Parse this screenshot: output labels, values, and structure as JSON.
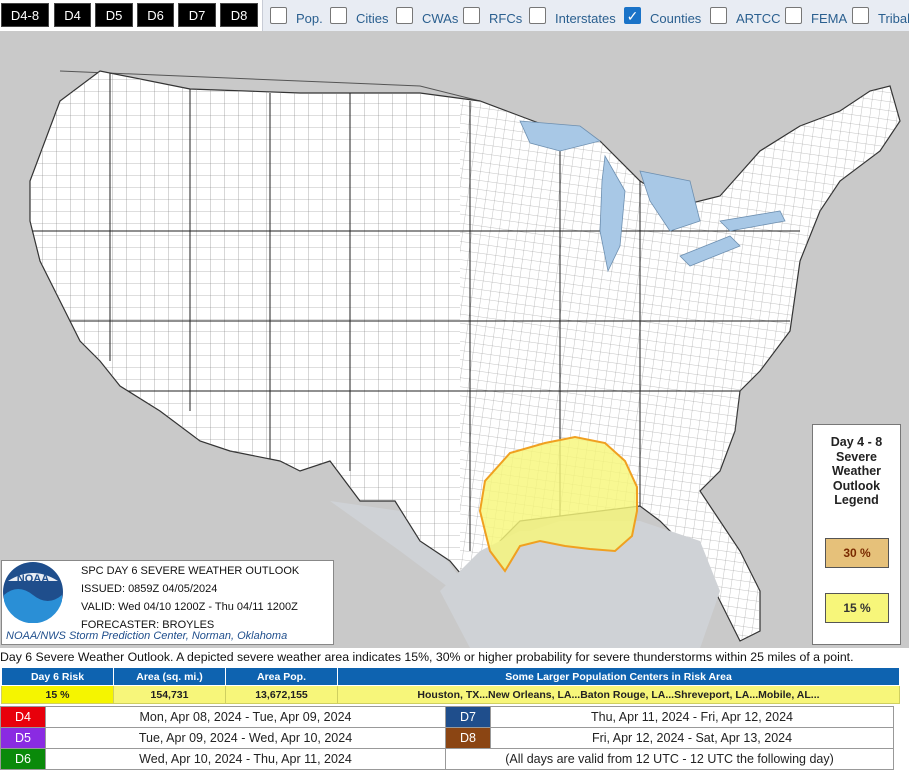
{
  "tabs": [
    "D4-8",
    "D4",
    "D5",
    "D6",
    "D7",
    "D8"
  ],
  "layers": [
    {
      "label": "Pop.",
      "checked": false
    },
    {
      "label": "Cities",
      "checked": false
    },
    {
      "label": "CWAs",
      "checked": false
    },
    {
      "label": "RFCs",
      "checked": false
    },
    {
      "label": "Interstates",
      "checked": false
    },
    {
      "label": "Counties",
      "checked": true
    },
    {
      "label": "ARTCC",
      "checked": false
    },
    {
      "label": "FEMA",
      "checked": false
    },
    {
      "label": "Tribal",
      "checked": false
    }
  ],
  "info_box": {
    "logo_text": "NOAA",
    "title": "SPC DAY 6 SEVERE WEATHER OUTLOOK",
    "issued": "ISSUED: 0859Z 04/05/2024",
    "valid": "VALID: Wed 04/10 1200Z - Thu 04/11 1200Z",
    "forecaster": "FORECASTER: BROYLES",
    "credit": "NOAA/NWS Storm Prediction Center, Norman, Oklahoma"
  },
  "legend": {
    "title_lines": [
      "Day 4 - 8",
      "Severe",
      "Weather",
      "Outlook",
      "Legend"
    ],
    "items": [
      {
        "label": "30 %",
        "color": "#e6c17a"
      },
      {
        "label": "15 %",
        "color": "#f7f67a"
      }
    ]
  },
  "description": "Day 6 Severe Weather Outlook. A depicted severe weather area indicates 15%, 30% or higher probability for severe thunderstorms within 25 miles of a point.",
  "risk_table": {
    "headers": [
      "Day 6 Risk",
      "Area (sq. mi.)",
      "Area Pop.",
      "Some Larger Population Centers in Risk Area"
    ],
    "row": [
      "15 %",
      "154,731",
      "13,672,155",
      "Houston, TX...New Orleans, LA...Baton Rouge, LA...Shreveport, LA...Mobile, AL..."
    ]
  },
  "day_table": [
    {
      "left_tag": "D4",
      "left_color": "#e8000b",
      "left_dates": "Mon, Apr 08, 2024 - Tue, Apr 09, 2024",
      "right_tag": "D7",
      "right_color": "#1f4e8c",
      "right_dates": "Thu, Apr 11, 2024 - Fri, Apr 12, 2024"
    },
    {
      "left_tag": "D5",
      "left_color": "#8a2be2",
      "left_dates": "Tue, Apr 09, 2024 - Wed, Apr 10, 2024",
      "right_tag": "D8",
      "right_color": "#8b4513",
      "right_dates": "Fri, Apr 12, 2024 - Sat, Apr 13, 2024"
    },
    {
      "left_tag": "D6",
      "left_color": "#0a8a0a",
      "left_dates": "Wed, Apr 10, 2024 - Thu, Apr 11, 2024",
      "right_tag": "",
      "right_color": "#ffffff",
      "right_dates": "(All days are valid from 12 UTC - 12 UTC the following day)"
    }
  ],
  "colors": {
    "ocean": "#c9c9c9",
    "land": "#ffffff",
    "water": "#a8c8e6",
    "risk15": "#f7f67a",
    "risk_outline": "#f0a020",
    "header_blue": "#0e63b0"
  }
}
